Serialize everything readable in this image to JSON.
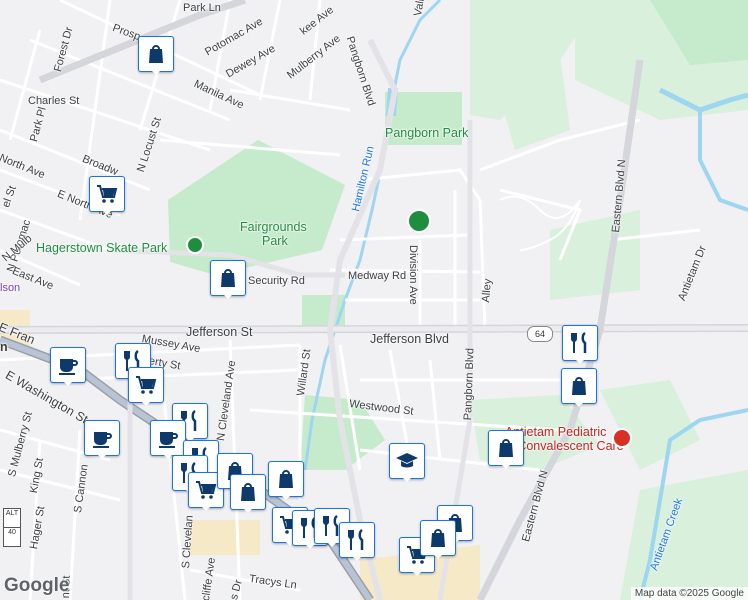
{
  "streets": {
    "park_ln": "Park Ln",
    "potomac_ave": "Potomac Ave",
    "dewey_ave": "Dewey Ave",
    "mulberry_ave": "Mulberry Ave",
    "kee_ave": "kee Ave",
    "prospect": "Prosp",
    "forest_dr": "Forest Dr",
    "manila_ave": "Manila Ave",
    "pangborn_blvd_n": "Pangborn Blvd",
    "charles_st": "Charles St",
    "park_pl": "Park Pl",
    "n_locust_st": "N Locust St",
    "broadway": "Broadw",
    "north_ave": "North Ave",
    "e_north_ave": "E North Ave",
    "n_potomac": "N Potomac",
    "el_st": "el St",
    "east_ave": "East Ave",
    "n_mulberry": "N Mulb",
    "security_rd": "Security Rd",
    "medway_rd": "Medway Rd",
    "division_ave": "Division Ave",
    "hamilton_run": "Hamilton Run",
    "alley": "Alley",
    "eastern_blvd_n_top": "Eastern Blvd N",
    "antietam_dr": "Antietam Dr",
    "e_fran": "E Fran",
    "mussey_ave": "Mussey Ave",
    "jefferson_st": "Jefferson St",
    "jefferson_blvd": "Jefferson Blvd",
    "erty_st": "erty St",
    "n_cleveland_ave": "N Cleveland Ave",
    "willard_st": "Willard St",
    "pangborn_blvd_s": "Pangborn Blvd",
    "e_washington_st": "E Washington St",
    "westwood_st": "Westwood St",
    "s_mulberry_st": "S Mulberry St",
    "s_cannon": "S Cannon",
    "king_st": "King St",
    "hager_st": "Hager St",
    "s_cleveland": "S Clevelan",
    "eastern_blvd_n_bottom": "Eastern Blvd N",
    "antietam_creek": "Antietam Creek",
    "tracys_ln": "Tracys Ln",
    "cliffe_ave": "cliffe Ave",
    "s_dr": "s Dr",
    "nt_st": "nt St",
    "valley": "Valle",
    "n": "n",
    "lson": "lson"
  },
  "places": {
    "pangborn_park": "Pangborn Park",
    "fairgrounds_park_1": "Fairgrounds",
    "fairgrounds_park_2": "Park",
    "skate_park": "Hagerstown Skate Park",
    "pediatric_1": "Antietam Pediatric",
    "pediatric_2": "and Convalescent Care"
  },
  "route_shields": {
    "jefferson": "64",
    "alt": "ALT",
    "us40": "40"
  },
  "pins": [
    {
      "icon": "shopping-bag-icon"
    },
    {
      "icon": "shopping-cart-icon"
    },
    {
      "icon": "shopping-bag-icon"
    },
    {
      "icon": "coffee-cup-icon"
    },
    {
      "icon": "fork-knife-icon"
    },
    {
      "icon": "shopping-cart-icon"
    },
    {
      "icon": "coffee-cup-icon"
    },
    {
      "icon": "fork-knife-icon"
    },
    {
      "icon": "coffee-cup-icon"
    },
    {
      "icon": "fork-knife-icon"
    },
    {
      "icon": "fork-knife-icon"
    },
    {
      "icon": "shopping-cart-icon"
    },
    {
      "icon": "shopping-bag-icon"
    },
    {
      "icon": "shopping-bag-icon"
    },
    {
      "icon": "shopping-bag-icon"
    },
    {
      "icon": "shopping-cart-icon"
    },
    {
      "icon": "fork-knife-icon"
    },
    {
      "icon": "fork-knife-icon"
    },
    {
      "icon": "fork-knife-icon"
    },
    {
      "icon": "graduation-cap-icon"
    },
    {
      "icon": "fork-knife-icon"
    },
    {
      "icon": "shopping-bag-icon"
    },
    {
      "icon": "shopping-bag-icon"
    },
    {
      "icon": "shopping-bag-icon"
    },
    {
      "icon": "shopping-cart-icon"
    },
    {
      "icon": "shopping-bag-icon"
    }
  ],
  "logo": "Google",
  "attribution": "Map data ©2025 Google",
  "colors": {
    "pin_blue": "#1a73e8",
    "park_green": "#c5eacc",
    "water": "#9ed5f0",
    "road_major": "#d5d6db",
    "background": "#f1f0f2"
  }
}
